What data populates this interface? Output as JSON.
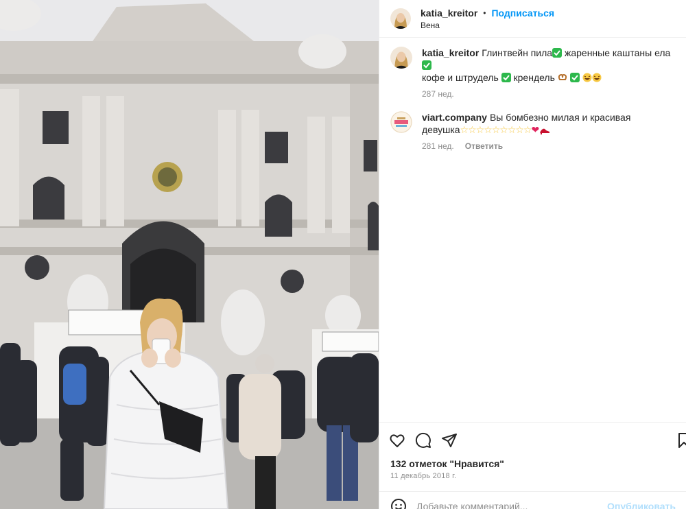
{
  "post": {
    "username": "katia_kreitor",
    "follow_label": "Подписаться",
    "location": "Вена",
    "photo_alt": "Photo of a woman in a white puffer jacket drinking from a cup in front of the Hofburg palace in Vienna"
  },
  "comments": [
    {
      "author": "katia_kreitor",
      "text_line1": "Глинтвейн пила",
      "text_line1b": " жаренные каштаны ела ",
      "text_line2": "кофе и штрудель ",
      "text_line2b": " крендель ",
      "age": "287 нед.",
      "reply_label": ""
    },
    {
      "author": "viart.company",
      "text_line1": "Вы бомбезно милая и красивая",
      "text_line2": "девушка",
      "age": "281 нед.",
      "reply_label": "Ответить"
    }
  ],
  "likes_text": "132 отметок \"Нравится\"",
  "date_text": "11 декабрь 2018 г.",
  "comment_input": {
    "placeholder": "Добавьте комментарий...",
    "value": ""
  },
  "publish_label": "Опубликовать",
  "icons": {
    "like": "heart-icon",
    "comment": "comment-icon",
    "share": "paper-plane-icon",
    "save": "bookmark-icon",
    "emoji": "smile-icon"
  },
  "colors": {
    "accent": "#0095f6",
    "muted": "#8e8e8e",
    "text": "#262626",
    "check_green": "#2db84c"
  }
}
